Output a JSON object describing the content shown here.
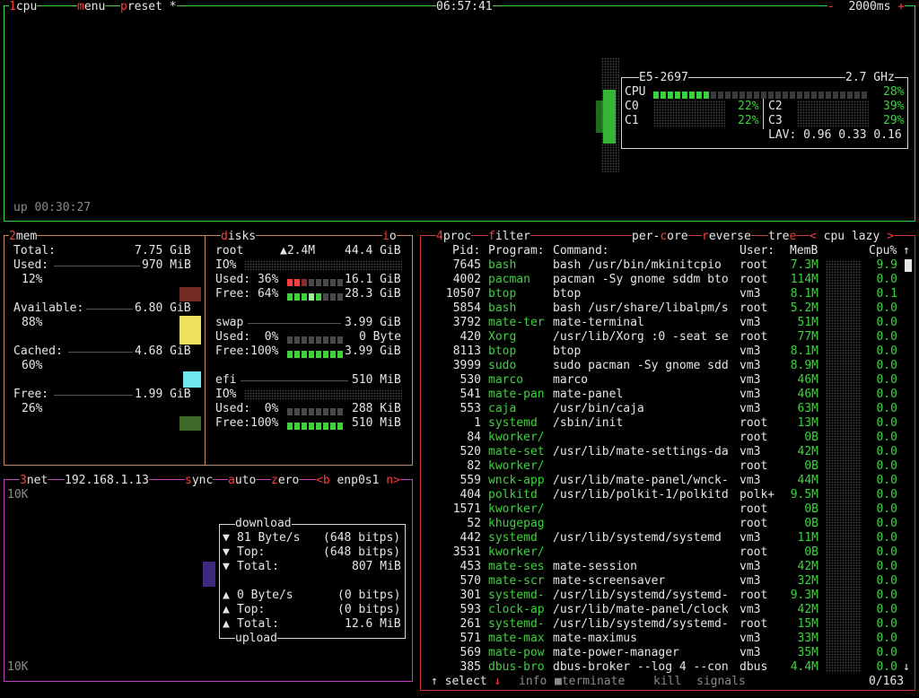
{
  "cpu_box": {
    "num": "1",
    "title": "cpu",
    "menu_num": "m",
    "menu": "enu",
    "preset_num": "p",
    "preset": "reset *",
    "clock": "06:57:41",
    "interval_minus": "-",
    "interval": "2000ms",
    "interval_plus": "+",
    "uptime": "up 00:30:27",
    "model": "E5-2697",
    "freq": "2.7 GHz",
    "cpu_label": "CPU",
    "cpu_pct": "28%",
    "cores": [
      {
        "name": "C0",
        "pct": "22%"
      },
      {
        "name": "C2",
        "pct": "39%"
      },
      {
        "name": "C1",
        "pct": "22%"
      },
      {
        "name": "C3",
        "pct": "29%"
      }
    ],
    "lav": "LAV: 0.96 0.33 0.16"
  },
  "mem_box": {
    "num": "2",
    "title": "mem",
    "total_label": "Total:",
    "total": "7.75 GiB",
    "used_label": "Used:",
    "used": "970 MiB",
    "used_pct": "12%",
    "avail_label": "Available:",
    "avail": "6.80 GiB",
    "avail_pct": "88%",
    "cached_label": "Cached:",
    "cached": "4.68 GiB",
    "cached_pct": "60%",
    "free_label": "Free:",
    "free": "1.99 GiB",
    "free_pct": "26%"
  },
  "disks_box": {
    "title_num": "d",
    "title": "isks",
    "io_num": "i",
    "io": "o",
    "root_name": "root",
    "root_io": "▲2.4M",
    "root_size": "44.4 GiB",
    "root_io_label": "IO%",
    "root_used_label": "Used: 36%",
    "root_used": "16.1 GiB",
    "root_free_label": "Free: 64%",
    "root_free": "28.3 GiB",
    "swap_name": "swap",
    "swap_size": "3.99 GiB",
    "swap_used_label": "Used:  0%",
    "swap_used": "0 Byte",
    "swap_free_label": "Free:100%",
    "swap_free": "3.99 GiB",
    "efi_name": "efi",
    "efi_size": "510 MiB",
    "efi_io_label": "IO%",
    "efi_used_label": "Used:  0%",
    "efi_used": "288 KiB",
    "efi_free_label": "Free:100%",
    "efi_free": "510 MiB"
  },
  "net_box": {
    "num": "3",
    "title": "net",
    "ip": "192.168.1.13",
    "sync_s": "s",
    "sync": "ync",
    "auto_a": "a",
    "auto": "uto",
    "zero_z": "z",
    "zero": "ero",
    "iface_prev": "<b",
    "iface": "enp0s1",
    "iface_next": "n>",
    "scale_top": "10K",
    "scale_bottom": "10K",
    "download_title": "download",
    "upload_title": "upload",
    "dl_rate": "81 Byte/s",
    "dl_rate_bits": "(648 bitps)",
    "dl_top_label": "Top:",
    "dl_top_bits": "(648 bitps)",
    "dl_total_label": "Total:",
    "dl_total": "807 MiB",
    "ul_rate": "0 Byte/s",
    "ul_rate_bits": "(0 bitps)",
    "ul_top_label": "Top:",
    "ul_top_bits": "(0 bitps)",
    "ul_total_label": "Total:",
    "ul_total": "12.6 MiB"
  },
  "proc_box": {
    "num": "4",
    "title": "proc",
    "filter_f": "f",
    "filter": "ilter",
    "percore_pre": "per-",
    "percore_c": "c",
    "percore_post": "ore",
    "reverse_r": "r",
    "reverse": "everse",
    "tree_pre": "tre",
    "tree_e": "e",
    "sort_left": "<",
    "sort": "cpu lazy",
    "sort_right": ">",
    "headers": {
      "pid": "Pid:",
      "program": "Program:",
      "command": "Command:",
      "user": "User:",
      "mem": "MemB",
      "cpu": "Cpu%"
    },
    "rows": [
      {
        "pid": "7645",
        "program": "bash",
        "command": "bash /usr/bin/mkinitcpio",
        "user": "root",
        "mem": "7.3M",
        "cpu": "9.9"
      },
      {
        "pid": "4002",
        "program": "pacman",
        "command": "pacman -Sy gnome sddm bto",
        "user": "root",
        "mem": "114M",
        "cpu": "0.0"
      },
      {
        "pid": "10507",
        "program": "btop",
        "command": "btop",
        "user": "vm3",
        "mem": "8.1M",
        "cpu": "0.1"
      },
      {
        "pid": "5854",
        "program": "bash",
        "command": "bash /usr/share/libalpm/s",
        "user": "root",
        "mem": "5.2M",
        "cpu": "0.0"
      },
      {
        "pid": "3792",
        "program": "mate-ter",
        "command": "mate-terminal",
        "user": "vm3",
        "mem": "51M",
        "cpu": "0.0"
      },
      {
        "pid": "420",
        "program": "Xorg",
        "command": "/usr/lib/Xorg :0 -seat se",
        "user": "root",
        "mem": "77M",
        "cpu": "0.0"
      },
      {
        "pid": "8113",
        "program": "btop",
        "command": "btop",
        "user": "vm3",
        "mem": "8.1M",
        "cpu": "0.0"
      },
      {
        "pid": "3999",
        "program": "sudo",
        "command": "sudo pacman -Sy gnome sdd",
        "user": "vm3",
        "mem": "8.9M",
        "cpu": "0.0"
      },
      {
        "pid": "530",
        "program": "marco",
        "command": "marco",
        "user": "vm3",
        "mem": "46M",
        "cpu": "0.0"
      },
      {
        "pid": "541",
        "program": "mate-pan",
        "command": "mate-panel",
        "user": "vm3",
        "mem": "46M",
        "cpu": "0.0"
      },
      {
        "pid": "553",
        "program": "caja",
        "command": "/usr/bin/caja",
        "user": "vm3",
        "mem": "63M",
        "cpu": "0.0"
      },
      {
        "pid": "1",
        "program": "systemd",
        "command": "/sbin/init",
        "user": "root",
        "mem": "13M",
        "cpu": "0.0"
      },
      {
        "pid": "84",
        "program": "kworker/",
        "command": "",
        "user": "root",
        "mem": "0B",
        "cpu": "0.0"
      },
      {
        "pid": "520",
        "program": "mate-set",
        "command": "/usr/lib/mate-settings-da",
        "user": "vm3",
        "mem": "42M",
        "cpu": "0.0"
      },
      {
        "pid": "82",
        "program": "kworker/",
        "command": "",
        "user": "root",
        "mem": "0B",
        "cpu": "0.0"
      },
      {
        "pid": "559",
        "program": "wnck-app",
        "command": "/usr/lib/mate-panel/wnck-",
        "user": "vm3",
        "mem": "44M",
        "cpu": "0.0"
      },
      {
        "pid": "404",
        "program": "polkitd",
        "command": "/usr/lib/polkit-1/polkitd",
        "user": "polk+",
        "mem": "9.5M",
        "cpu": "0.0"
      },
      {
        "pid": "1571",
        "program": "kworker/",
        "command": "",
        "user": "root",
        "mem": "0B",
        "cpu": "0.0"
      },
      {
        "pid": "52",
        "program": "khugepag",
        "command": "",
        "user": "root",
        "mem": "0B",
        "cpu": "0.0"
      },
      {
        "pid": "442",
        "program": "systemd",
        "command": "/usr/lib/systemd/systemd",
        "user": "vm3",
        "mem": "11M",
        "cpu": "0.0"
      },
      {
        "pid": "3531",
        "program": "kworker/",
        "command": "",
        "user": "root",
        "mem": "0B",
        "cpu": "0.0"
      },
      {
        "pid": "453",
        "program": "mate-ses",
        "command": "mate-session",
        "user": "vm3",
        "mem": "42M",
        "cpu": "0.0"
      },
      {
        "pid": "570",
        "program": "mate-scr",
        "command": "mate-screensaver",
        "user": "vm3",
        "mem": "32M",
        "cpu": "0.0"
      },
      {
        "pid": "301",
        "program": "systemd-",
        "command": "/usr/lib/systemd/systemd-",
        "user": "root",
        "mem": "9.3M",
        "cpu": "0.0"
      },
      {
        "pid": "593",
        "program": "clock-ap",
        "command": "/usr/lib/mate-panel/clock",
        "user": "vm3",
        "mem": "42M",
        "cpu": "0.0"
      },
      {
        "pid": "261",
        "program": "systemd-",
        "command": "/usr/lib/systemd/systemd-",
        "user": "root",
        "mem": "15M",
        "cpu": "0.0"
      },
      {
        "pid": "571",
        "program": "mate-max",
        "command": "mate-maximus",
        "user": "vm3",
        "mem": "33M",
        "cpu": "0.0"
      },
      {
        "pid": "569",
        "program": "mate-pow",
        "command": "mate-power-manager",
        "user": "vm3",
        "mem": "35M",
        "cpu": "0.0"
      },
      {
        "pid": "385",
        "program": "dbus-bro",
        "command": "dbus-broker --log 4 --con",
        "user": "dbus",
        "mem": "4.4M",
        "cpu": "0.0"
      }
    ],
    "footer": {
      "select_arrow": "↑",
      "select": "select",
      "select_down": "↓",
      "info": "info",
      "terminate_t": "t",
      "terminate": "erminate",
      "kill_k": "k",
      "kill": "ill",
      "signals_s": "s",
      "signals": "ignals",
      "count": "0/163"
    }
  },
  "colors": {
    "cpu_border": "#3bd43b",
    "mem_border": "#c98a5e",
    "net_border": "#c040c0",
    "proc_border": "#c83c3c",
    "accent_red": "#ff3b3b",
    "green": "#3bd43b"
  }
}
